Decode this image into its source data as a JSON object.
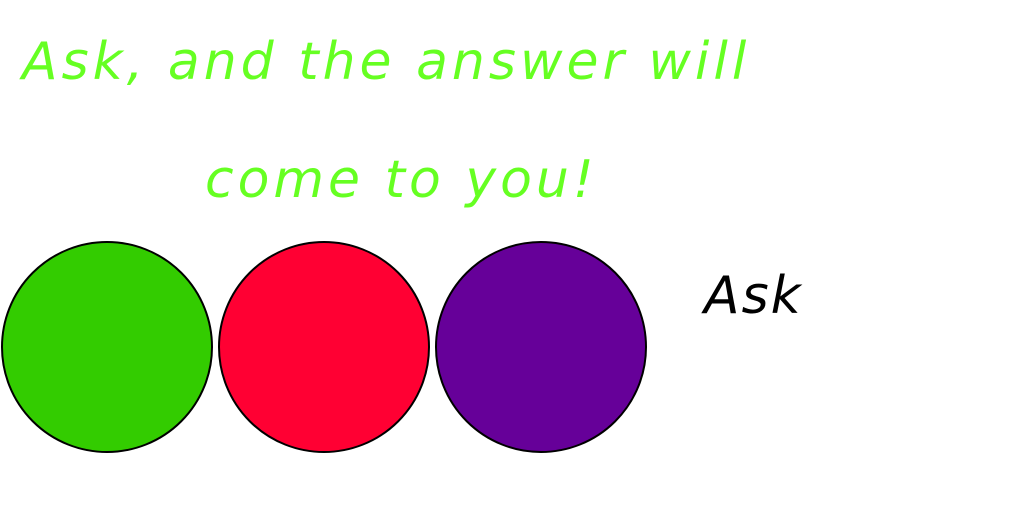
{
  "heading": {
    "line1": "Ask, and the answer will",
    "line2": "come to you!",
    "color": "#66ff22"
  },
  "circles": [
    {
      "name": "green",
      "color": "#33cc00"
    },
    {
      "name": "red",
      "color": "#ff0033"
    },
    {
      "name": "purple",
      "color": "#660099"
    }
  ],
  "ask_button": {
    "label": "Ask",
    "color": "#000000"
  }
}
